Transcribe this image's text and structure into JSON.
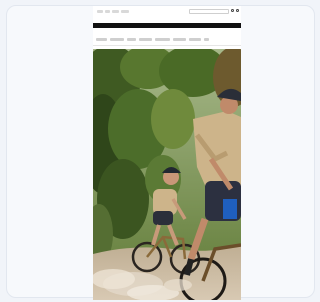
{
  "site": {
    "logo": "",
    "utility_links": [
      "",
      "",
      "",
      ""
    ],
    "search": {
      "placeholder": ""
    },
    "nav": [
      "",
      "",
      "",
      "",
      "",
      "",
      "",
      ""
    ]
  },
  "hero": {
    "image": "cyclists-gravel-hero",
    "colors": {
      "foliage": "#4f6b2c",
      "jacket": "#cdb48a",
      "path": "#c8b39a"
    }
  },
  "colors": {
    "frame_bg": "#f1f4f9",
    "card_bg": "#f7f9fc",
    "promo_bar": "#111111"
  }
}
